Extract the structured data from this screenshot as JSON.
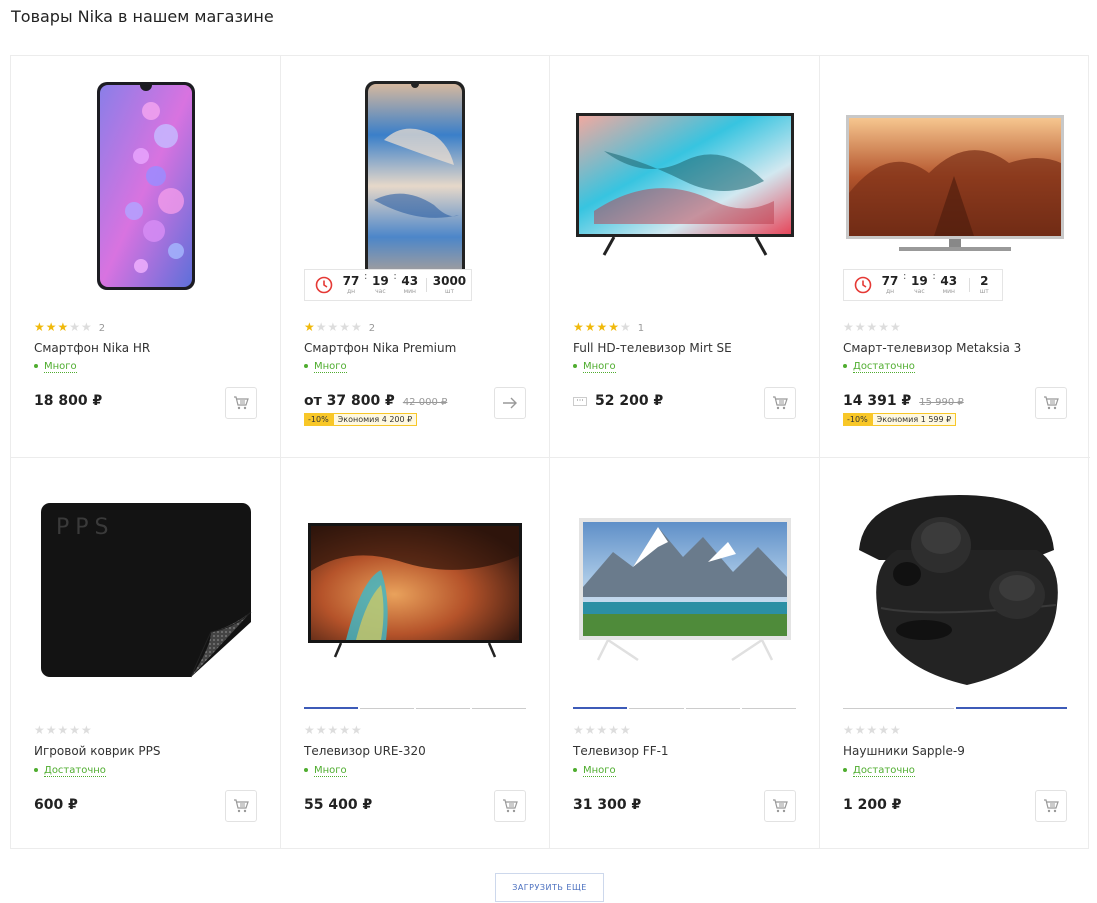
{
  "section_title": "Товары Nika в нашем магазине",
  "currency": "₽",
  "colors": {
    "star_on": "#f0b90b",
    "stock_green": "#4fad2f",
    "discount_yellow": "#f8c728",
    "accent_blue": "#3d5bb8"
  },
  "products": [
    {
      "name": "Смартфон Nika HR",
      "rating": 3,
      "reviews": "2",
      "stock": "Много",
      "price": "18 800 ₽",
      "action_icon": "cart-icon",
      "image": "smartphone-purple"
    },
    {
      "name": "Смартфон Nika Premium",
      "rating": 1,
      "reviews": "2",
      "stock": "Много",
      "price": "от 37 800 ₽",
      "old_price": "42 000 ₽",
      "discount": "-10%",
      "saving": "Экономия 4 200 ₽",
      "action_icon": "arrow-right-icon",
      "image": "smartphone-watercolor",
      "timer": {
        "days": "77",
        "days_label": "дн",
        "hours": "19",
        "hours_label": "час",
        "minutes": "43",
        "minutes_label": "мин",
        "qty": "3000",
        "qty_label": "шт"
      }
    },
    {
      "name": "Full HD-телевизор Mirt SE",
      "rating": 4,
      "reviews": "1",
      "stock": "Много",
      "price": "52 200 ₽",
      "price_prefix_icon": "more-options-icon",
      "action_icon": "cart-icon",
      "image": "tv-coral"
    },
    {
      "name": "Смарт-телевизор Metaksia 3",
      "rating": 0,
      "reviews": "",
      "stock": "Достаточно",
      "price": "14 391 ₽",
      "old_price": "15 990 ₽",
      "discount": "-10%",
      "saving": "Экономия 1 599 ₽",
      "action_icon": "cart-icon",
      "image": "tv-canyon",
      "timer": {
        "days": "77",
        "days_label": "дн",
        "hours": "19",
        "hours_label": "час",
        "minutes": "43",
        "minutes_label": "мин",
        "qty": "2",
        "qty_label": "шт"
      }
    },
    {
      "name": "Игровой коврик PPS",
      "rating": 0,
      "reviews": "",
      "stock": "Достаточно",
      "price": "600 ₽",
      "action_icon": "cart-icon",
      "image": "mousepad",
      "image_logo": "PPS"
    },
    {
      "name": "Телевизор URE-320",
      "rating": 0,
      "reviews": "",
      "stock": "Много",
      "price": "55 400 ₽",
      "action_icon": "cart-icon",
      "image": "tv-cave",
      "gallery_slides": 4,
      "gallery_active": 1
    },
    {
      "name": "Телевизор FF-1",
      "rating": 0,
      "reviews": "",
      "stock": "Много",
      "price": "31 300 ₽",
      "action_icon": "cart-icon",
      "image": "tv-mountains",
      "gallery_slides": 4,
      "gallery_active": 1
    },
    {
      "name": "Наушники Sapple-9",
      "rating": 0,
      "reviews": "",
      "stock": "Достаточно",
      "price": "1 200 ₽",
      "action_icon": "cart-icon",
      "image": "earbuds",
      "gallery_slides": 2,
      "gallery_active": 2
    }
  ],
  "load_more": "ЗАГРУЗИТЬ ЕЩЕ"
}
